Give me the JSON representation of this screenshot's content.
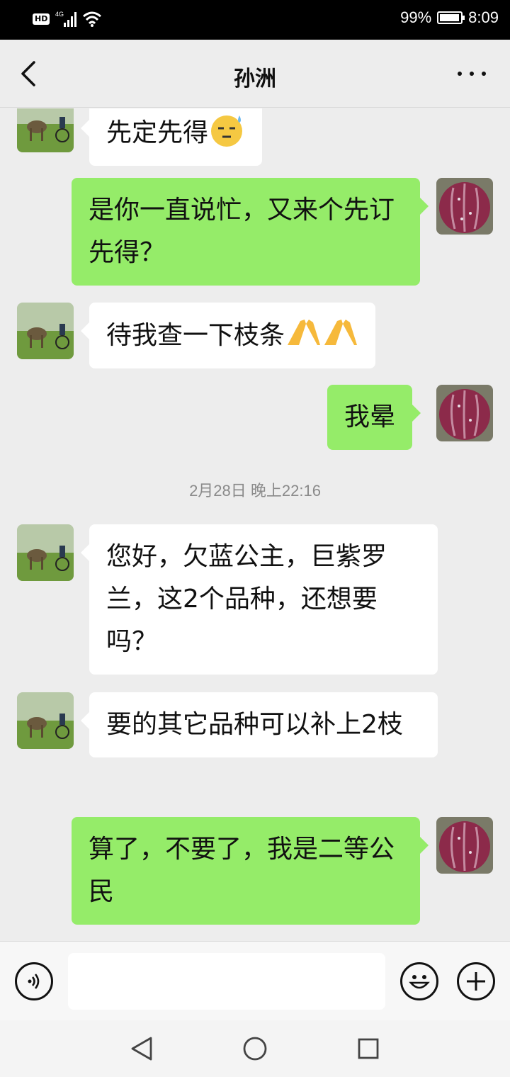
{
  "status_bar": {
    "hd": "HD",
    "network": "4G",
    "battery": "99%",
    "time": "8:09"
  },
  "header": {
    "title": "孙洲"
  },
  "messages": [
    {
      "side": "in",
      "text": "先定先得",
      "emoji": "cold-sweat-emoji"
    },
    {
      "side": "out",
      "text": "是你一直说忙，又来个先订先得？"
    },
    {
      "side": "in",
      "text": "待我查一下枝条",
      "emoji": "folded-hands-emoji x2"
    },
    {
      "side": "out",
      "text": "我晕"
    },
    {
      "timestamp": "2月28日 晚上22:16"
    },
    {
      "side": "in",
      "text": "您好，欠蓝公主，巨紫罗兰，这2个品种，还想要吗？"
    },
    {
      "side": "in",
      "text": "要的其它品种可以补上2枝"
    },
    {
      "side": "out",
      "text": "算了，不要了，我是二等公民"
    }
  ],
  "input": {
    "value": "",
    "placeholder": ""
  },
  "colors": {
    "outgoing_bubble": "#95ec69",
    "incoming_bubble": "#ffffff",
    "chat_background": "#ededed"
  },
  "icons": {
    "back": "chevron-left-icon",
    "more": "more-dots-icon",
    "voice": "voice-icon",
    "emoji": "smiley-icon",
    "plus": "plus-icon",
    "nav_back": "triangle-back-icon",
    "nav_home": "circle-home-icon",
    "nav_recent": "square-recent-icon"
  }
}
